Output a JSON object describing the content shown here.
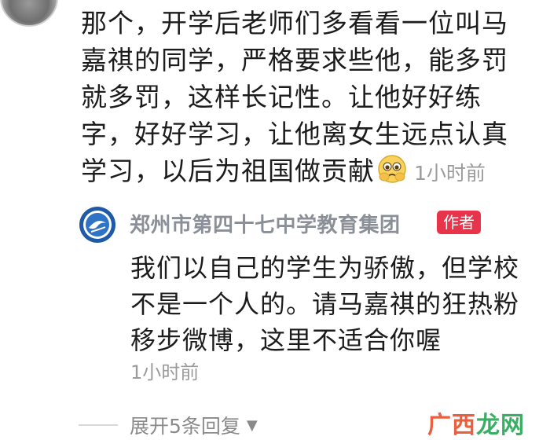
{
  "comment": {
    "text": "那个，开学后老师们多看看一位叫马嘉祺的同学，严格要求些他，能多罚就多罚，这样长记性。让他好好练字，好好学习，让他离女生远点认真学习，以后为祖国做贡献",
    "emoji": "pleading-emoji",
    "time": "1小时前"
  },
  "reply": {
    "name": "郑州市第四十七中学教育集团",
    "badge": "作者",
    "text": "我们以自己的学生为骄傲，但学校不是一个人的。请马嘉祺的狂热粉移步微博，这里不适合你喔",
    "time": "1小时前"
  },
  "expand": {
    "label": "展开5条回复",
    "icon": "chevron-down-icon"
  },
  "watermark": {
    "part1": "广西",
    "part2": "龙网"
  },
  "colors": {
    "badge": "#e8344a",
    "meta": "#9b9b9b",
    "name": "#8a8f98"
  }
}
